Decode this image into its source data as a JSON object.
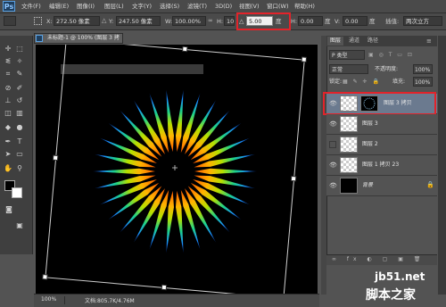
{
  "app": {
    "logo": "Ps",
    "menus": [
      "文件(F)",
      "编辑(E)",
      "图像(I)",
      "图层(L)",
      "文字(Y)",
      "选择(S)",
      "滤镜(T)",
      "3D(D)",
      "视图(V)",
      "窗口(W)",
      "帮助(H)"
    ]
  },
  "options": {
    "x_label": "X:",
    "x_value": "272.50 像素",
    "y_label": "Y:",
    "y_value": "247.50 像素",
    "w_label": "W:",
    "w_value": "100.00%",
    "h_label": "H:",
    "h_value": "100.00%",
    "rotate_icon": "△",
    "rotate_value": "5.00",
    "rotate_unit": "度",
    "hskew_label": "H:",
    "hskew_value": "0.00",
    "hskew_unit": "度",
    "vskew_label": "V:",
    "vskew_value": "0.00",
    "vskew_unit": "度",
    "interp_label": "插值:",
    "interp_value": "两次立方",
    "highlight_color": "#e2232a"
  },
  "document": {
    "tab_title": "未标题-1 @ 100% (图层 3 拷贝, RGB/8) *",
    "zoom": "100%",
    "doc_info": "文档:805.7K/4.76M"
  },
  "layers_panel": {
    "tabs": [
      "图层",
      "通道",
      "路径"
    ],
    "kind_label": "P 类型",
    "blend_mode": "正常",
    "opacity_label": "不透明度:",
    "opacity_value": "100%",
    "lock_label": "锁定:",
    "fill_label": "填充:",
    "fill_value": "100%",
    "layers": [
      {
        "name": "图层 3 拷贝",
        "visible": true,
        "selected": true
      },
      {
        "name": "图层 3",
        "visible": true,
        "selected": false
      },
      {
        "name": "图层 2",
        "visible": false,
        "selected": false
      },
      {
        "name": "图层 1 拷贝 23",
        "visible": true,
        "selected": false
      },
      {
        "name": "背景",
        "visible": true,
        "selected": false
      }
    ]
  },
  "watermark": {
    "line1": "jb51.net",
    "line2": "脚本之家"
  }
}
